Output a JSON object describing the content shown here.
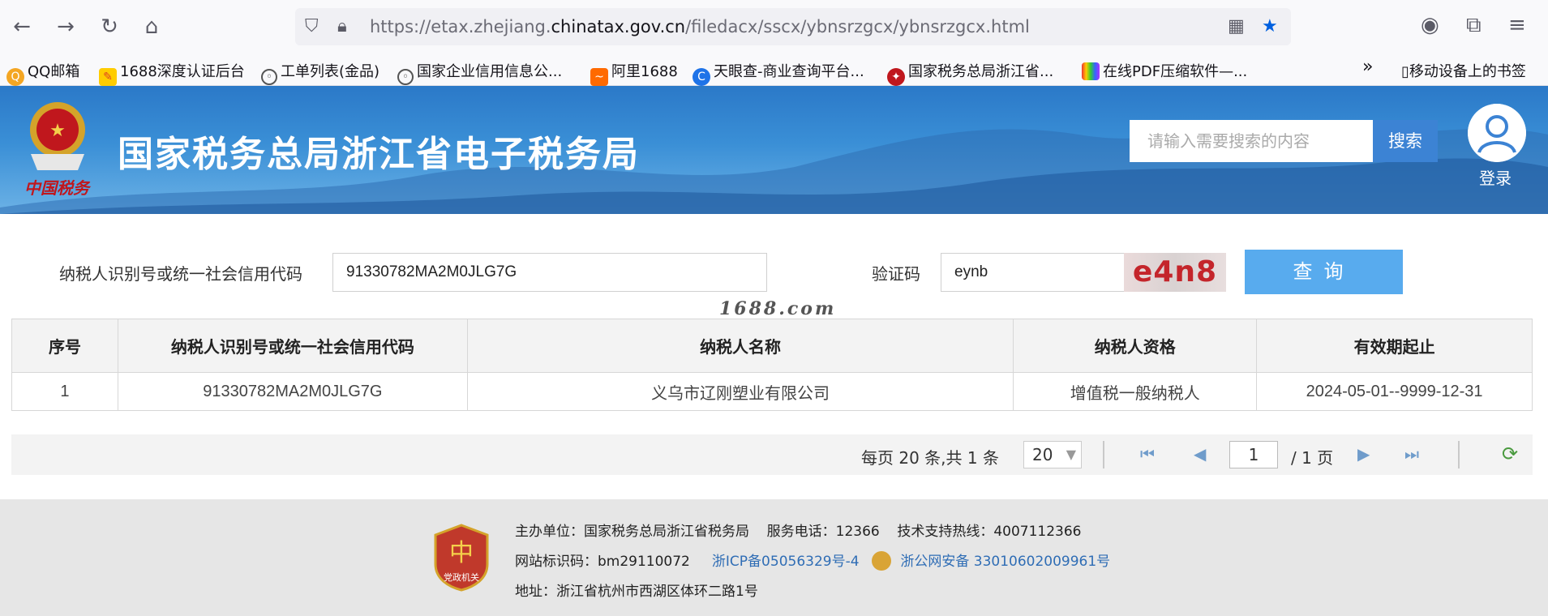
{
  "browser": {
    "url_prefix": "https://etax.zhejiang.",
    "url_domain": "chinatax.gov.cn",
    "url_path": "/filedacx/sscx/ybnsrzgcx/ybnsrzgcx.html",
    "bookmarks": [
      {
        "label": "QQ邮箱",
        "color": "#f4a623"
      },
      {
        "label": "1688深度认证后台",
        "color": "#ff6a00"
      },
      {
        "label": "工单列表(金品)",
        "color": "#555555"
      },
      {
        "label": "国家企业信用信息公...",
        "color": "#555555"
      },
      {
        "label": "阿里1688",
        "color": "#ff6a00"
      },
      {
        "label": "天眼查-商业查询平台...",
        "color": "#1e73e8"
      },
      {
        "label": "国家税务总局浙江省...",
        "color": "#c0171d"
      },
      {
        "label": "在线PDF压缩软件—...",
        "color": "#7a4de0"
      }
    ],
    "mobile_bookmarks": "移动设备上的书签"
  },
  "header": {
    "site_title": "国家税务总局浙江省电子税务局",
    "emblem_caption": "中国税务",
    "search_placeholder": "请输入需要搜索的内容",
    "search_button": "搜索",
    "login_label": "登录"
  },
  "form": {
    "taxpayer_id_label": "纳税人识别号或统一社会信用代码",
    "taxpayer_id_value": "91330782MA2M0JLG7G",
    "captcha_label": "验证码",
    "captcha_value": "eynb",
    "captcha_image_text": "e4n8",
    "query_button": "查询",
    "watermark": "1688.com"
  },
  "table": {
    "headers": [
      "序号",
      "纳税人识别号或统一社会信用代码",
      "纳税人名称",
      "纳税人资格",
      "有效期起止"
    ],
    "rows": [
      [
        "1",
        "91330782MA2M0JLG7G",
        "义乌市辽刚塑业有限公司",
        "增值税一般纳税人",
        "2024-05-01--9999-12-31"
      ]
    ]
  },
  "pager": {
    "summary": "每页 20 条,共 1 条",
    "page_size": "20",
    "current_page": "1",
    "total_pages": "/ 1 页"
  },
  "footer": {
    "host": "主办单位：国家税务总局浙江省税务局",
    "phone": "服务电话：12366",
    "support": "技术支持热线：4007112366",
    "site_id": "网站标识码：bm29110072",
    "icp": "浙ICP备05056329号-4",
    "police_record": "浙公网安备 33010602009961号",
    "address": "地址：浙江省杭州市西湖区体环二路1号",
    "logo_text": "党政机关"
  },
  "colors": {
    "banner_blue": "#2b79c8",
    "query_button": "#58abee",
    "link_blue": "#2f6db5",
    "captcha_red": "#c4252b"
  }
}
